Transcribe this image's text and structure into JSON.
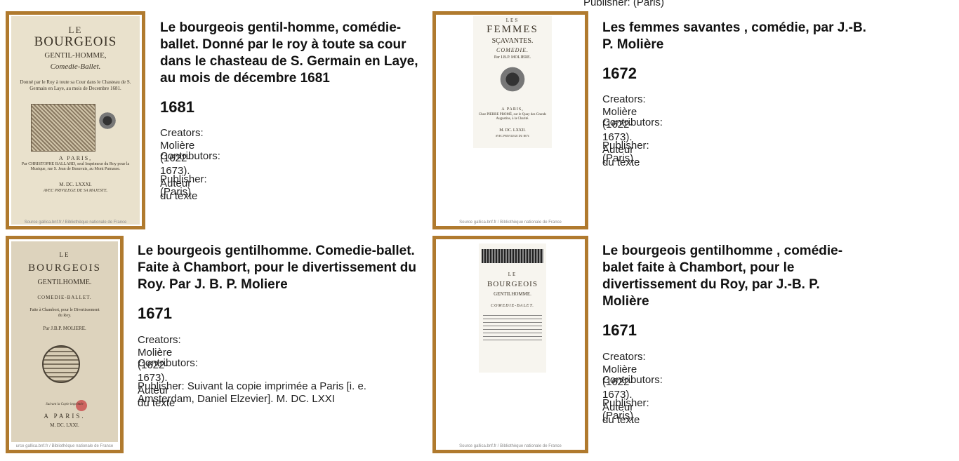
{
  "overflow_publisher": "Publisher: (Paris)",
  "source_label": "Source gallica.bnf.fr / Bibliothèque nationale de France",
  "source_label_cropped": "urce gallica.bnf.fr / Bibliothèque nationale de France",
  "results": [
    {
      "title": "Le bourgeois gentil-homme, comédie-ballet. Donné par le roy à toute sa cour dans le chasteau de S. Germain en Laye, au mois de décembre 1681",
      "year": "1681",
      "creators": "Creators: Molière (1622-1673). Auteur du texte",
      "contributors": "Contributors:",
      "publisher": "Publisher: (Paris)",
      "cover": {
        "l1": "LE",
        "l2": "BOURGEOIS",
        "l3": "GENTIL-HOMME,",
        "l4": "Comedie-Ballet.",
        "l5": "Donné par le Roy à toute sa Cour dans le Chasteau de S. Germain en Laye, au mois de Decembre 1681.",
        "l6": "A PARIS,",
        "l7": "Par CHRISTOPHE BALLARD, seul Imprimeur du Roy pour la Musique, rue S. Jean de Beauvais, au Mont Parnasse.",
        "l8": "M. DC. LXXXI.",
        "l9": "AVEC PRIVILEGE DE SA MAJESTE."
      }
    },
    {
      "title": "Les femmes savantes , comédie, par J.-B. P. Molière",
      "year": "1672",
      "creators": "Creators: Molière (1622-1673). Auteur du texte",
      "contributors": "Contributors:",
      "publisher": "Publisher: (Paris)",
      "cover": {
        "l1": "LES",
        "l2": "FEMMES",
        "l3": "SÇAVANTES.",
        "l4": "COMEDIE.",
        "l5": "Par I.B.P. MOLIERE.",
        "l6": "A PARIS,",
        "l7": "Chez PIERRE PROMÉ, sur le Quay des Grands Augustins, à la Charité.",
        "l8": "M. DC. LXXII.",
        "l9": "AVEC PRIVILEGE DU ROY."
      }
    },
    {
      "title": "Le bourgeois gentilhomme. Comedie-ballet. Faite à Chambort, pour le divertissement du Roy. Par J. B. P. Moliere",
      "year": "1671",
      "creators": "Creators: Molière (1622-1673). Auteur du texte",
      "contributors": "Contributors:",
      "publisher": "Publisher: Suivant la copie imprimée a Paris [i. e. Amsterdam, Daniel Elzevier]. M. DC. LXXI",
      "cover": {
        "l1": "LE",
        "l2": "BOURGEOIS",
        "l3": "GENTILHOMME.",
        "l4": "COMEDIE-BALLET.",
        "l5": "Faite à Chambort, pour le Divertissement du Roy.",
        "l6": "Par J.B.P. MOLIERE.",
        "l7": "Suivant la Copie imprimée",
        "l8": "A PARIS.",
        "l9": "M. DC. LXXI."
      }
    },
    {
      "title": "Le bourgeois gentilhomme , comédie-balet faite à Chambort, pour le divertissement du Roy, par J.-B. P. Molière",
      "year": "1671",
      "creators": "Creators: Molière (1622-1673). Auteur du texte",
      "contributors": "Contributors:",
      "publisher": "Publisher: (Paris)",
      "cover": {
        "l1": "LE",
        "l2": "BOURGEOIS",
        "l3": "GENTILHOMME.",
        "l4": "COMEDIE-BALET."
      }
    }
  ]
}
